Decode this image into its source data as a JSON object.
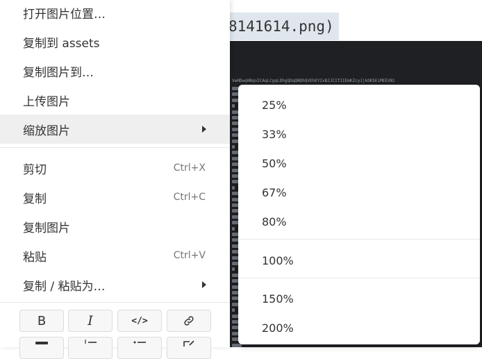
{
  "background": {
    "filename_fragment": "8141614.png)",
    "code_top_line": "VwHDwqHBqoICAqLCgqLDhgQDqQNDhQVEhEYIxBJJCIfIIEmKZcyJjkOKSEiMEEXNi"
  },
  "menu": {
    "items": [
      {
        "label": "打开图片位置…"
      },
      {
        "label": "复制到 assets"
      },
      {
        "label": "复制图片到…"
      },
      {
        "label": "上传图片"
      },
      {
        "label": "缩放图片"
      },
      {
        "label": "剪切",
        "shortcut": "Ctrl+X"
      },
      {
        "label": "复制",
        "shortcut": "Ctrl+C"
      },
      {
        "label": "复制图片"
      },
      {
        "label": "粘贴",
        "shortcut": "Ctrl+V"
      },
      {
        "label": "复制 / 粘贴为…"
      }
    ],
    "format_buttons": [
      {
        "name": "bold",
        "icon": "bold-icon",
        "glyph": "B"
      },
      {
        "name": "italic",
        "icon": "italic-icon",
        "glyph": "I"
      },
      {
        "name": "code",
        "icon": "code-icon",
        "glyph": "</>"
      },
      {
        "name": "link",
        "icon": "link-icon",
        "glyph": ""
      }
    ]
  },
  "zoom_submenu": {
    "items": [
      "25%",
      "33%",
      "50%",
      "67%",
      "80%",
      "100%",
      "150%",
      "200%"
    ]
  }
}
